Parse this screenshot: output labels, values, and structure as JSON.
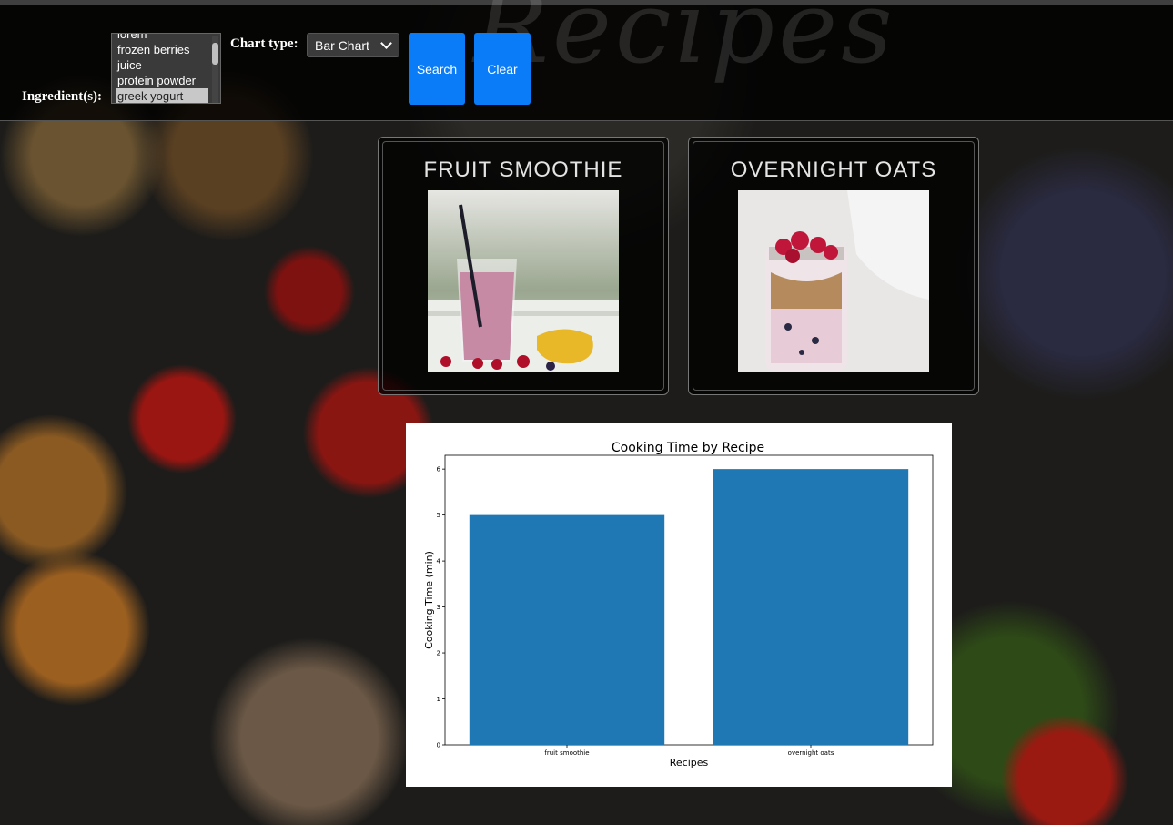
{
  "header": {
    "watermark": "Recipes",
    "ingredient_label": "Ingredient(s):",
    "ingredients": [
      "lorem",
      "frozen berries",
      "juice",
      "protein powder",
      "greek yogurt"
    ],
    "selected_ingredient": "greek yogurt",
    "chart_type_label": "Chart type:",
    "chart_type_value": "Bar Chart",
    "search_label": "Search",
    "clear_label": "Clear",
    "accent_color": "#0a7cf7"
  },
  "recipes": [
    {
      "title": "FRUIT SMOOTHIE"
    },
    {
      "title": "OVERNIGHT OATS"
    }
  ],
  "chart_data": {
    "type": "bar",
    "title": "Cooking Time by Recipe",
    "xlabel": "Recipes",
    "ylabel": "Cooking Time (min)",
    "categories": [
      "fruit smoothie",
      "overnight oats"
    ],
    "values": [
      5,
      6
    ],
    "ylim": [
      0,
      6.3
    ],
    "yticks": [
      "0",
      "1",
      "2",
      "3",
      "4",
      "5",
      "6"
    ],
    "color": "#1f77b4",
    "grid": false
  }
}
